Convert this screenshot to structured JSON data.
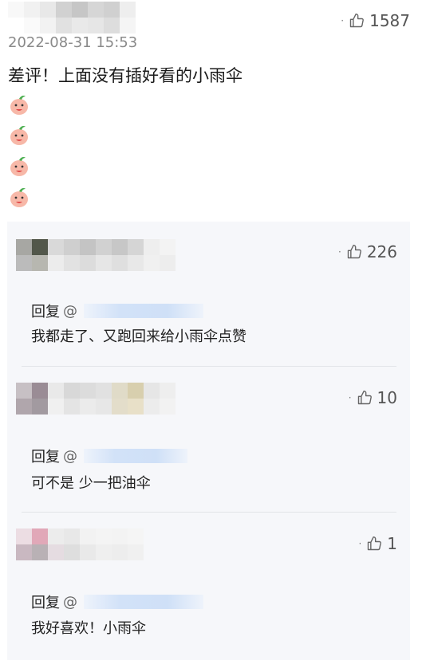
{
  "main_comment": {
    "timestamp": "2022-08-31 15:53",
    "likes": "1587",
    "text": "差评！上面没有插好看的小雨伞",
    "emoji_count": 4
  },
  "replies": [
    {
      "likes": "226",
      "reply_prefix": "回复",
      "at_symbol": "@",
      "text": "我都走了、又跑回来给小雨伞点赞"
    },
    {
      "likes": "10",
      "reply_prefix": "回复",
      "at_symbol": "@",
      "text": "可不是 少一把油伞"
    },
    {
      "likes": "1",
      "reply_prefix": "回复",
      "at_symbol": "@",
      "text": "我好喜欢！小雨伞"
    }
  ],
  "colors": {
    "panel_bg": "#f6f7fa",
    "mention_blur": "#cfe0f7",
    "text": "#1a1a1a",
    "muted": "#8a8a8a"
  },
  "icons": {
    "like": "thumbs-up-icon",
    "emoji": "peach-face-emoji"
  }
}
